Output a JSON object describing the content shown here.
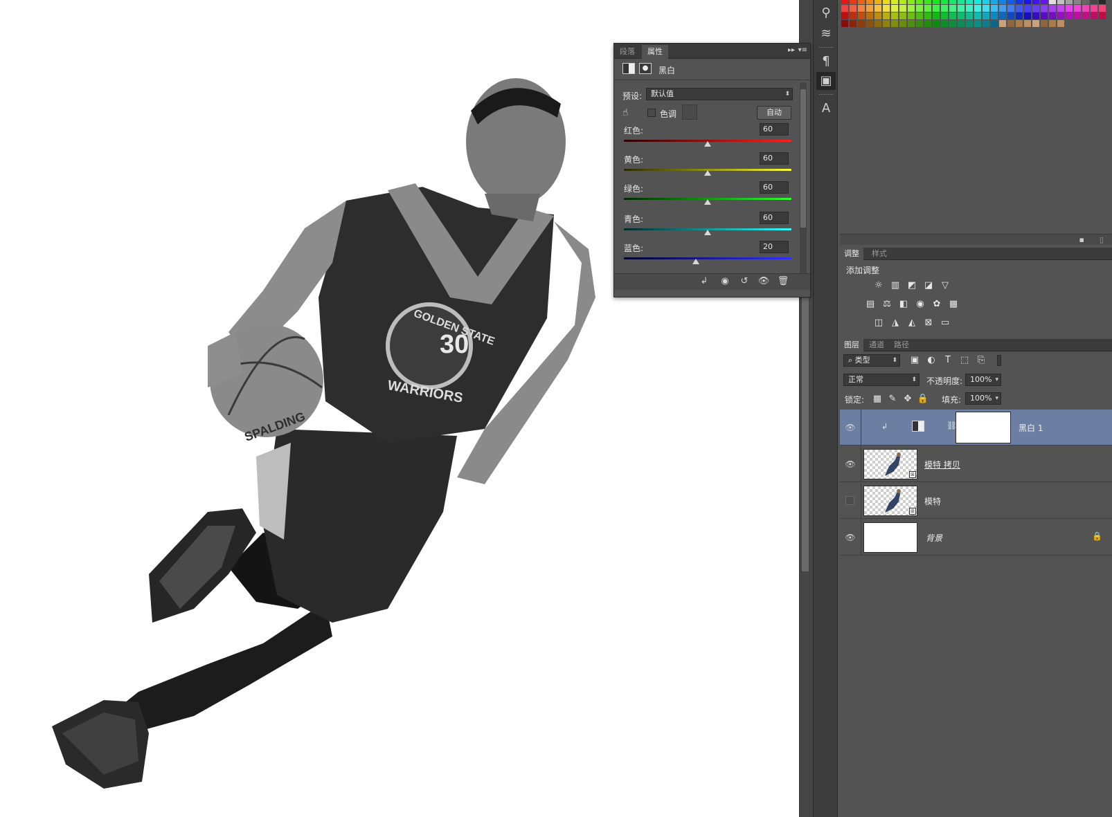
{
  "properties_panel": {
    "tabs": [
      "段落",
      "属性"
    ],
    "active_tab": "属性",
    "title": "黑白",
    "preset_label": "预设:",
    "preset_value": "默认值",
    "tint_label": "色调",
    "auto_button": "自动",
    "sliders": [
      {
        "label": "红色:",
        "value": "60",
        "fraction": 0.5,
        "gradient": "linear-gradient(to right,#2a0000,#ff2020)"
      },
      {
        "label": "黄色:",
        "value": "60",
        "fraction": 0.5,
        "gradient": "linear-gradient(to right,#282800,#ffff30)"
      },
      {
        "label": "绿色:",
        "value": "60",
        "fraction": 0.5,
        "gradient": "linear-gradient(to right,#002800,#30ff30)"
      },
      {
        "label": "青色:",
        "value": "60",
        "fraction": 0.5,
        "gradient": "linear-gradient(to right,#002828,#30ffff)"
      },
      {
        "label": "蓝色:",
        "value": "20",
        "fraction": 0.43,
        "gradient": "linear-gradient(to right,#000028,#3030ff)"
      }
    ]
  },
  "adjustments_panel": {
    "tabs": [
      "调整",
      "样式"
    ],
    "active_tab": "调整",
    "heading": "添加调整"
  },
  "layers_panel": {
    "tabs": [
      "图层",
      "通道",
      "路径"
    ],
    "active_tab": "图层",
    "filter_kind": "类型",
    "blend_mode": "正常",
    "opacity_label": "不透明度:",
    "opacity_value": "100%",
    "lock_label": "锁定:",
    "fill_label": "填充:",
    "fill_value": "100%",
    "layers": [
      {
        "name": "黑白 1",
        "visible": true,
        "selected": true,
        "type": "adjustment"
      },
      {
        "name": "模特 拷贝",
        "visible": true,
        "selected": false,
        "type": "smart"
      },
      {
        "name": "模特",
        "visible": false,
        "selected": false,
        "type": "smart"
      },
      {
        "name": "背景",
        "visible": true,
        "selected": false,
        "type": "background",
        "locked": true
      }
    ]
  },
  "canvas": {
    "jersey_line1": "GOLDEN STATE",
    "jersey_number": "30",
    "jersey_line2": "WARRIORS",
    "ball_brand": "SPALDING"
  }
}
